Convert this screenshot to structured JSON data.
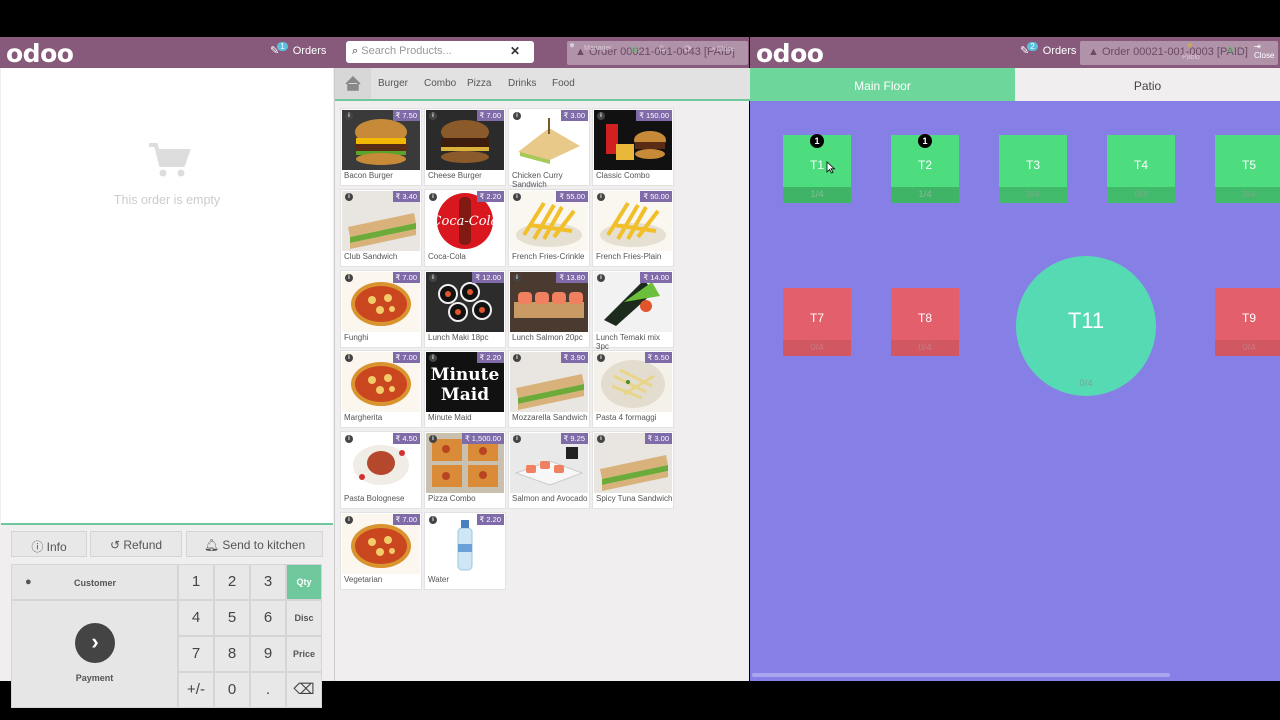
{
  "pos": {
    "logo": "odoo",
    "orders_label": "Orders",
    "orders_count": "1",
    "search_placeholder": "Search Products...",
    "ghost_order": "Order 00021-001-0043 [PAID]",
    "user_label": "Manager",
    "close_label": "Close",
    "order": {
      "empty_text": "This order is empty"
    },
    "actions": {
      "info": "Info",
      "refund": "Refund",
      "send_to_kitchen": "Send to kitchen"
    },
    "numpad": {
      "customer": "Customer",
      "payment": "Payment",
      "keys": [
        "1",
        "2",
        "3",
        "4",
        "5",
        "6",
        "7",
        "8",
        "9",
        "+/-",
        "0",
        "."
      ],
      "modes": [
        "Qty",
        "Disc",
        "Price"
      ],
      "active_mode": "Qty"
    },
    "categories": [
      "Burger",
      "Combo",
      "Pizza",
      "Drinks",
      "Food"
    ],
    "products": [
      {
        "name": "Bacon Burger",
        "price": "₹ 7.50",
        "img": "burger"
      },
      {
        "name": "Cheese Burger",
        "price": "₹ 7.00",
        "img": "burger-dark"
      },
      {
        "name": "Chicken Curry Sandwich",
        "price": "₹ 3.00",
        "img": "sandwich"
      },
      {
        "name": "Classic Combo",
        "price": "₹ 150.00",
        "img": "combo"
      },
      {
        "name": "Club Sandwich",
        "price": "₹ 3.40",
        "img": "club"
      },
      {
        "name": "Coca-Cola",
        "price": "₹ 2.20",
        "img": "coke"
      },
      {
        "name": "French Fries-Crinkle",
        "price": "₹ 55.00",
        "img": "fries"
      },
      {
        "name": "French Fries-Plain",
        "price": "₹ 50.00",
        "img": "fries"
      },
      {
        "name": "Funghi",
        "price": "₹ 7.00",
        "img": "pizza"
      },
      {
        "name": "Lunch Maki 18pc",
        "price": "₹ 12.00",
        "img": "maki"
      },
      {
        "name": "Lunch Salmon 20pc",
        "price": "₹ 13.80",
        "img": "salmon"
      },
      {
        "name": "Lunch Temaki mix 3pc",
        "price": "₹ 14.00",
        "img": "temaki"
      },
      {
        "name": "Margherita",
        "price": "₹ 7.00",
        "img": "pizza"
      },
      {
        "name": "Minute Maid",
        "price": "₹ 2.20",
        "img": "minute",
        "logo_line1": "Minute",
        "logo_line2": "Maid"
      },
      {
        "name": "Mozzarella Sandwich",
        "price": "₹ 3.90",
        "img": "club"
      },
      {
        "name": "Pasta 4 formaggi",
        "price": "₹ 5.50",
        "img": "pasta"
      },
      {
        "name": "Pasta Bolognese",
        "price": "₹ 4.50",
        "img": "bolognese"
      },
      {
        "name": "Pizza Combo",
        "price": "₹ 1,500.00",
        "img": "pizzacombo"
      },
      {
        "name": "Salmon and Avocado",
        "price": "₹ 9.25",
        "img": "salmonavo"
      },
      {
        "name": "Spicy Tuna Sandwich",
        "price": "₹ 3.00",
        "img": "club"
      },
      {
        "name": "Vegetarian",
        "price": "₹ 7.00",
        "img": "pizza"
      },
      {
        "name": "Water",
        "price": "₹ 2.20",
        "img": "water"
      }
    ]
  },
  "floor": {
    "logo": "odoo",
    "orders_label": "Orders",
    "orders_count": "2",
    "ghost_order": "Order 00021-001-0003 [PAID]",
    "user_label": "Pablo",
    "close_label": "Close",
    "tabs": [
      {
        "label": "Main Floor",
        "active": true
      },
      {
        "label": "Patio",
        "active": false
      }
    ],
    "tables": [
      {
        "name": "T1",
        "seats": "1/4",
        "orders": "1",
        "color": "green"
      },
      {
        "name": "T2",
        "seats": "1/4",
        "orders": "1",
        "color": "green"
      },
      {
        "name": "T3",
        "seats": "0/4",
        "orders": "",
        "color": "green"
      },
      {
        "name": "T4",
        "seats": "0/4",
        "orders": "",
        "color": "green"
      },
      {
        "name": "T5",
        "seats": "0/4",
        "orders": "",
        "color": "green"
      },
      {
        "name": "T7",
        "seats": "0/4",
        "orders": "",
        "color": "red"
      },
      {
        "name": "T8",
        "seats": "0/4",
        "orders": "",
        "color": "red"
      },
      {
        "name": "T9",
        "seats": "0/4",
        "orders": "",
        "color": "red"
      },
      {
        "name": "T11",
        "seats": "0/4",
        "orders": "",
        "color": "teal"
      }
    ]
  },
  "colors": {
    "brand": "#875a7b",
    "accent_green": "#6ec89b",
    "floor_bg": "#8680e6",
    "price_badge": "#7f6ba8"
  }
}
